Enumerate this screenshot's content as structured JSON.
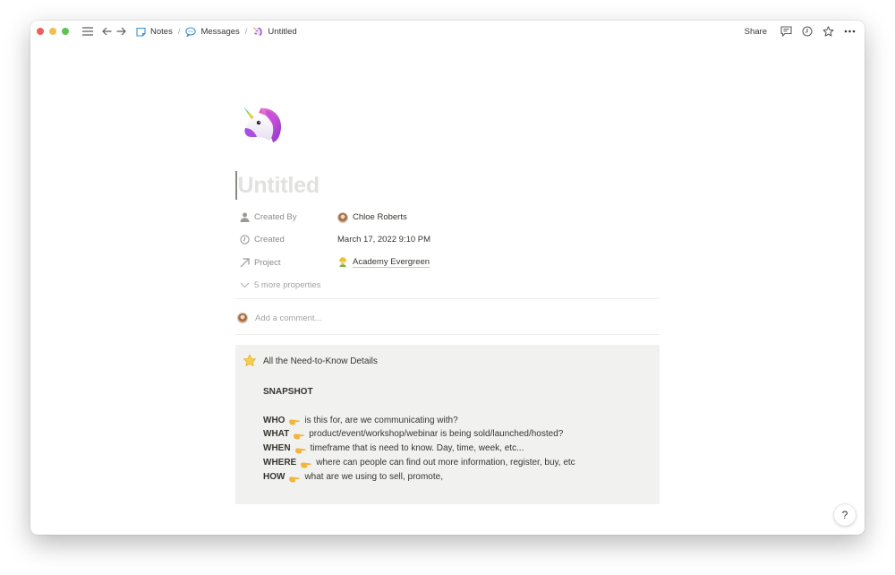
{
  "topbar": {
    "breadcrumbs": [
      {
        "label": "Notes",
        "icon": "notes-page-icon"
      },
      {
        "label": "Messages",
        "icon": "speech-bubble-icon"
      },
      {
        "label": "Untitled",
        "icon": "unicorn-icon"
      }
    ],
    "separator": "/",
    "share_label": "Share",
    "actions": [
      "comments-icon",
      "history-clock-icon",
      "favorite-star-icon",
      "more-dots-icon"
    ]
  },
  "page": {
    "icon": "unicorn-emoji",
    "title_placeholder": "Untitled",
    "properties": [
      {
        "key": "Created By",
        "icon": "person-icon",
        "value": "Chloe Roberts",
        "value_icon": "avatar"
      },
      {
        "key": "Created",
        "icon": "clock-icon",
        "value": "March 17, 2022 9:10 PM"
      },
      {
        "key": "Project",
        "icon": "arrow-up-right-icon",
        "value": "Academy Evergreen",
        "value_icon": "construction-worker-emoji"
      }
    ],
    "more_properties": "5 more properties",
    "comment_placeholder": "Add a comment..."
  },
  "callout": {
    "icon": "star-emoji",
    "title": "All the Need-to-Know Details",
    "heading": "SNAPSHOT",
    "lines": [
      {
        "key": "WHO",
        "text": "is this for, are we communicating with?"
      },
      {
        "key": "WHAT",
        "text": "product/event/workshop/webinar is being sold/launched/hosted?"
      },
      {
        "key": "WHEN",
        "text": "timeframe that is need to know. Day, time, week, etc..."
      },
      {
        "key": "WHERE",
        "text": "where can people can find out more information, register, buy, etc"
      },
      {
        "key": "HOW",
        "text": "what are we using to sell, promote,"
      }
    ]
  },
  "help": {
    "label": "?"
  }
}
